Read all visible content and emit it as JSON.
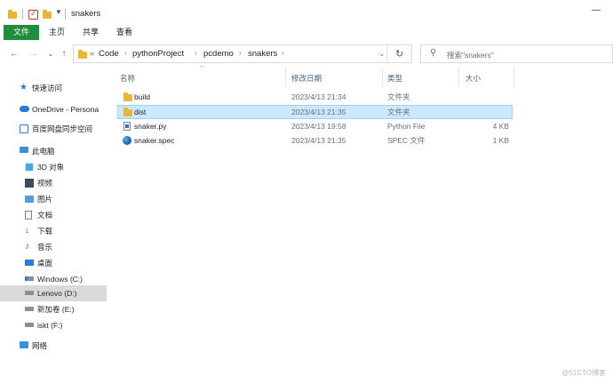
{
  "window": {
    "title": "snakers",
    "minimize_glyph": "—"
  },
  "ribbon": {
    "tabs": [
      {
        "label": "文件",
        "active": true
      },
      {
        "label": "主页"
      },
      {
        "label": "共享"
      },
      {
        "label": "查看"
      }
    ]
  },
  "address": {
    "overflow": "«",
    "crumbs": [
      "Code",
      "pythonProject",
      "pcdemo",
      "snakers"
    ],
    "refresh_glyph": "↻",
    "search_placeholder": "搜索\"snakers\""
  },
  "sidebar": {
    "items": [
      {
        "label": "快速访问",
        "icon": "star-icon"
      },
      {
        "label": "OneDrive - Persona",
        "icon": "cloud-icon"
      },
      {
        "label": "百度网盘同步空间",
        "icon": "baidu-sync-icon"
      },
      {
        "label": "此电脑",
        "icon": "computer-icon"
      },
      {
        "label": "3D 对象",
        "icon": "cube-icon"
      },
      {
        "label": "视频",
        "icon": "video-icon"
      },
      {
        "label": "图片",
        "icon": "picture-icon"
      },
      {
        "label": "文档",
        "icon": "document-icon"
      },
      {
        "label": "下载",
        "icon": "download-icon"
      },
      {
        "label": "音乐",
        "icon": "music-icon"
      },
      {
        "label": "桌面",
        "icon": "desktop-icon"
      },
      {
        "label": "Windows (C:)",
        "icon": "drive-windows-icon"
      },
      {
        "label": "Lenovo (D:)",
        "icon": "drive-icon",
        "selected": true
      },
      {
        "label": "新加卷 (E:)",
        "icon": "drive-icon"
      },
      {
        "label": "iskt (F:)",
        "icon": "drive-icon"
      },
      {
        "label": "网络",
        "icon": "network-icon"
      }
    ]
  },
  "columns": {
    "name": "名称",
    "modified": "修改日期",
    "type": "类型",
    "size": "大小"
  },
  "files": [
    {
      "name": "build",
      "modified": "2023/4/13 21:34",
      "type": "文件夹",
      "size": "",
      "icon": "folder-icon"
    },
    {
      "name": "dist",
      "modified": "2023/4/13 21:35",
      "type": "文件夹",
      "size": "",
      "icon": "folder-icon",
      "selected": true
    },
    {
      "name": "snaker.py",
      "modified": "2023/4/13 19:58",
      "type": "Python File",
      "size": "4 KB",
      "icon": "python-file-icon"
    },
    {
      "name": "snaker.spec",
      "modified": "2023/4/13 21:35",
      "type": "SPEC 文件",
      "size": "1 KB",
      "icon": "spec-file-icon"
    }
  ],
  "watermark": "@51CTO博客",
  "colors": {
    "file_tab": "#1e8d3d",
    "selection": "#cce8ff",
    "folder": "#e8b63a",
    "nav_selected": "#d9d9d9"
  }
}
